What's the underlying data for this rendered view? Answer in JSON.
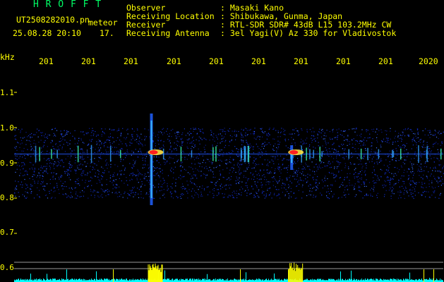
{
  "header": {
    "station": "H R O F F T",
    "filename": "UT2508282010.pn",
    "detection": "meteor",
    "datetime": "25.08.28 20:10",
    "count": "17.",
    "fields": [
      {
        "label": "Observer",
        "value": ": Masaki Kano"
      },
      {
        "label": "Receiving Location",
        "value": ": Shibukawa, Gunma, Japan"
      },
      {
        "label": "Receiver",
        "value": ": RTL-SDR SDR# 43dB L15 103.2MHz CW"
      },
      {
        "label": "Receiving Antenna",
        "value": ": 3el Yagi(V) Az 330 for Vladivostok"
      }
    ]
  },
  "axis": {
    "unit": "kHz",
    "y_ticks": [
      "1.1",
      "1.0",
      "0.9",
      "0.8",
      "0.7",
      "0.6"
    ],
    "time_labels": [
      "201",
      "201",
      "201",
      "201",
      "201",
      "201",
      "201",
      "201",
      "201",
      "2020"
    ]
  },
  "colors": {
    "text": "#ffff00",
    "station": "#00ff66",
    "background": "#000000",
    "echo_peak": "#ff2020",
    "noise": "#1a3cff",
    "level_trace": "#00ffff",
    "level_peak": "#ffff00"
  },
  "chart_data": {
    "type": "heatmap",
    "title": "H R O F F T",
    "ylabel": "kHz",
    "ylim": [
      0.58,
      1.15
    ],
    "noise_band_khz": [
      0.8,
      1.0
    ],
    "carrier_khz": 0.925,
    "meteor_echoes": [
      {
        "label": "echo-1",
        "time_index": 2.6,
        "khz": 0.93,
        "strength": "strong",
        "spread_khz": [
          0.78,
          1.04
        ]
      },
      {
        "label": "echo-2",
        "time_index": 5.9,
        "khz": 0.93,
        "strength": "strong",
        "spread_khz": [
          0.88,
          0.95
        ]
      }
    ]
  }
}
